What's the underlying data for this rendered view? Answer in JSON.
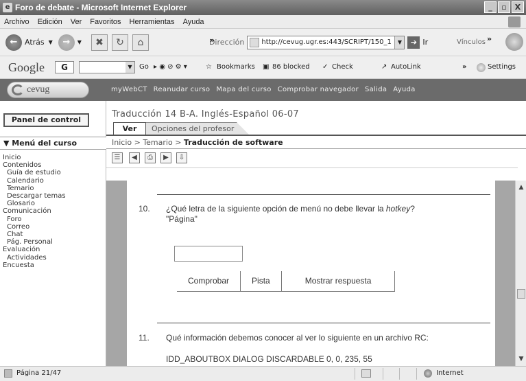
{
  "window": {
    "title": "Foro de debate - Microsoft Internet Explorer",
    "buttons": [
      "_",
      "▫",
      "X"
    ]
  },
  "menubar": [
    "Archivo",
    "Edición",
    "Ver",
    "Favoritos",
    "Herramientas",
    "Ayuda"
  ],
  "navbar": {
    "back": "Atrás",
    "address_label": "Dirección",
    "address": "http://cevug.ugr.es:443/SCRIPT/150_1",
    "go": "Ir",
    "links": "Vínculos"
  },
  "google": {
    "logo": "Google",
    "selector": "G",
    "go": "Go",
    "bookmarks": "Bookmarks",
    "blocked": "86 blocked",
    "check": "Check",
    "autolink": "AutoLink",
    "settings": "Settings"
  },
  "webct": {
    "logo": "cevug",
    "nav": [
      "myWebCT",
      "Reanudar curso",
      "Mapa del curso",
      "Comprobar navegador",
      "Salida",
      "Ayuda"
    ]
  },
  "left": {
    "panel_button": "Panel de control",
    "menu_title": "Menú del curso",
    "items": [
      {
        "label": "Inicio",
        "indent": false
      },
      {
        "label": "Contenidos",
        "indent": false
      },
      {
        "label": "Guía de estudio",
        "indent": true
      },
      {
        "label": "Calendario",
        "indent": true
      },
      {
        "label": "Temario",
        "indent": true
      },
      {
        "label": "Descargar temas",
        "indent": true
      },
      {
        "label": "Glosario",
        "indent": true
      },
      {
        "label": "Comunicación",
        "indent": false
      },
      {
        "label": "Foro",
        "indent": true
      },
      {
        "label": "Correo",
        "indent": true
      },
      {
        "label": "Chat",
        "indent": true
      },
      {
        "label": "Pág. Personal",
        "indent": true
      },
      {
        "label": "Evaluación",
        "indent": false
      },
      {
        "label": "Actividades",
        "indent": true
      },
      {
        "label": "Encuesta",
        "indent": false
      }
    ]
  },
  "course": {
    "title": "Traducción 14 B-A. Inglés-Español 06-07",
    "tab_view": "Ver",
    "tab_options": "Opciones del profesor",
    "breadcrumb_prefix": "Inicio > Temario > ",
    "breadcrumb_current": "Traducción de software"
  },
  "questions": [
    {
      "number": "10.",
      "text_before": "¿Qué letra de la siguiente opción de menú no debe llevar la ",
      "text_emph": "hotkey",
      "text_after": "?",
      "line2": "\"Página\"",
      "buttons": [
        "Comprobar",
        "Pista",
        "Mostrar respuesta"
      ]
    },
    {
      "number": "11.",
      "text": "Qué información debemos conocer al ver lo siguiente en un archivo RC:",
      "line2": "IDD_ABOUTBOX DIALOG DISCARDABLE 0, 0, 235, 55"
    }
  ],
  "status": {
    "page": "Página 21/47",
    "zone": "Internet"
  }
}
